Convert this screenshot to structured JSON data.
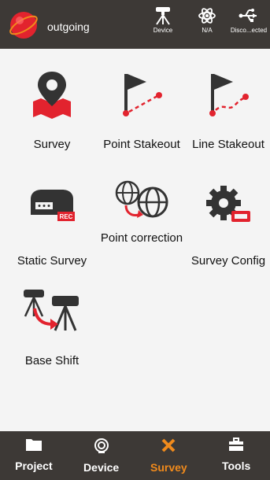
{
  "header": {
    "title": "outgoing",
    "status": [
      {
        "label": "Device",
        "icon": "gnss-receiver-icon"
      },
      {
        "label": "N/A",
        "icon": "satellite-icon"
      },
      {
        "label": "Disco...ected",
        "icon": "usb-icon"
      }
    ]
  },
  "tiles": [
    {
      "label": "Survey",
      "icon": "map-pin-icon"
    },
    {
      "label": "Point Stakeout",
      "icon": "point-stakeout-icon"
    },
    {
      "label": "Line Stakeout",
      "icon": "line-stakeout-icon"
    },
    {
      "label": "Static Survey",
      "icon": "static-receiver-icon"
    },
    {
      "label": "Point correction",
      "icon": "globe-correction-icon"
    },
    {
      "label": "Survey Config",
      "icon": "gear-config-icon"
    },
    {
      "label": "Base Shift",
      "icon": "base-shift-icon"
    }
  ],
  "nav": {
    "tabs": [
      {
        "label": "Project",
        "icon": "folder-icon"
      },
      {
        "label": "Device",
        "icon": "device-icon"
      },
      {
        "label": "Survey",
        "icon": "survey-icon",
        "active": true
      },
      {
        "label": "Tools",
        "icon": "toolbox-icon"
      }
    ]
  },
  "colors": {
    "bar": "#3d3936",
    "accent": "#f08a1c",
    "red": "#e2232e"
  }
}
